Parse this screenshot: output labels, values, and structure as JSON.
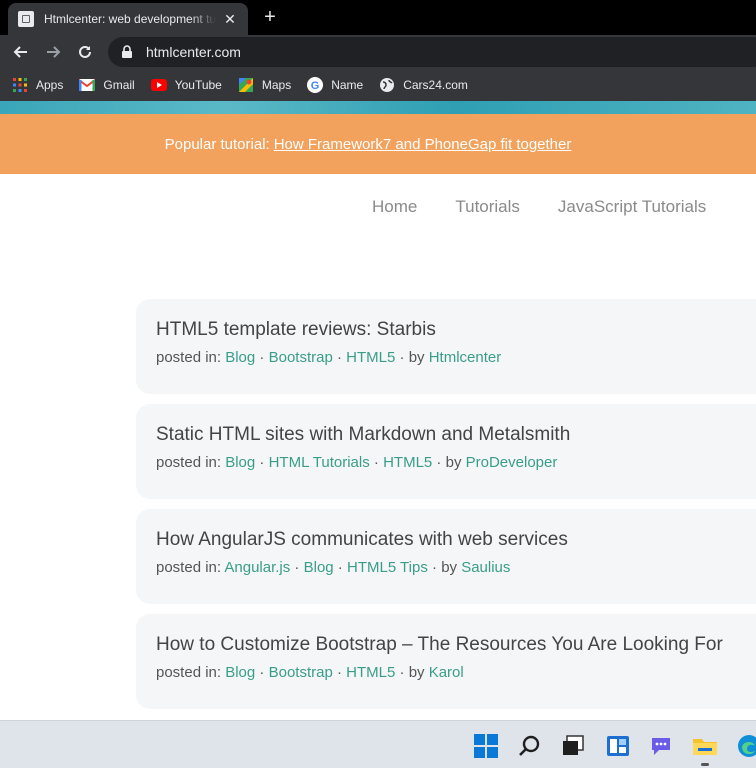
{
  "browser": {
    "tab_title": "Htmlcenter: web development tutorials",
    "url": "htmlcenter.com",
    "bookmarks": [
      {
        "label": "Apps",
        "icon": "apps-grid-icon"
      },
      {
        "label": "Gmail",
        "icon": "gmail-icon"
      },
      {
        "label": "YouTube",
        "icon": "youtube-icon"
      },
      {
        "label": "Maps",
        "icon": "maps-icon"
      },
      {
        "label": "Name",
        "icon": "google-icon"
      },
      {
        "label": "Cars24.com",
        "icon": "globe-icon"
      }
    ]
  },
  "banner": {
    "prefix": "Popular tutorial:",
    "link": "How Framework7 and PhoneGap fit together"
  },
  "nav": [
    "Home",
    "Tutorials",
    "JavaScript Tutorials"
  ],
  "posts": [
    {
      "title": "HTML5 template reviews: Starbis",
      "posted_in_label": "posted in:",
      "tags": [
        "Blog",
        "Bootstrap",
        "HTML5"
      ],
      "by_label": "by",
      "author": "Htmlcenter"
    },
    {
      "title": "Static HTML sites with Markdown and Metalsmith",
      "posted_in_label": "posted in:",
      "tags": [
        "Blog",
        "HTML Tutorials",
        "HTML5"
      ],
      "by_label": "by",
      "author": "ProDeveloper"
    },
    {
      "title": "How AngularJS communicates with web services",
      "posted_in_label": "posted in:",
      "tags": [
        "Angular.js",
        "Blog",
        "HTML5 Tips"
      ],
      "by_label": "by",
      "author": "Saulius"
    },
    {
      "title": "How to Customize Bootstrap – The Resources You Are Looking For",
      "posted_in_label": "posted in:",
      "tags": [
        "Blog",
        "Bootstrap",
        "HTML5"
      ],
      "by_label": "by",
      "author": "Karol"
    }
  ],
  "colors": {
    "banner": "#f2a25c",
    "link": "#3a9d8c",
    "card_bg": "#f5f6f7"
  }
}
